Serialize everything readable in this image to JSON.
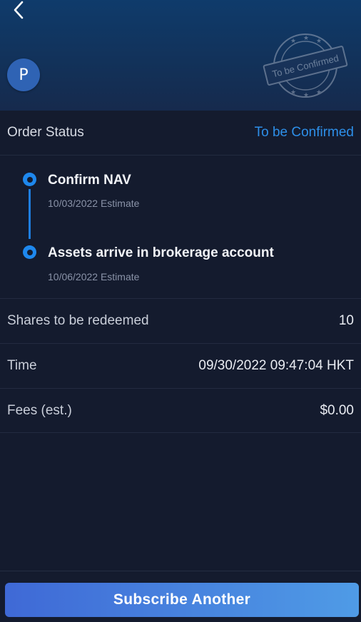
{
  "header": {
    "back_icon": "chevron-left-icon",
    "avatar_letter": "P",
    "stamp_text": "To be Confirmed",
    "stamp_icon": "stamp-seal-icon"
  },
  "order_status": {
    "label": "Order Status",
    "value": "To be Confirmed",
    "value_color": "#2d8fe9"
  },
  "timeline": [
    {
      "title": "Confirm NAV",
      "subtitle": "10/03/2022 Estimate"
    },
    {
      "title": "Assets arrive in brokerage account",
      "subtitle": "10/06/2022 Estimate"
    }
  ],
  "details": [
    {
      "label": "Shares to be redeemed",
      "value": "10"
    },
    {
      "label": "Time",
      "value": "09/30/2022 09:47:04 HKT"
    },
    {
      "label": "Fees (est.)",
      "value": "$0.00"
    }
  ],
  "actions": {
    "primary_label": "Subscribe Another"
  },
  "colors": {
    "accent": "#1e88ee",
    "background": "#141b2e",
    "button_gradient_start": "#3f69d6",
    "button_gradient_end": "#4f9be6"
  }
}
